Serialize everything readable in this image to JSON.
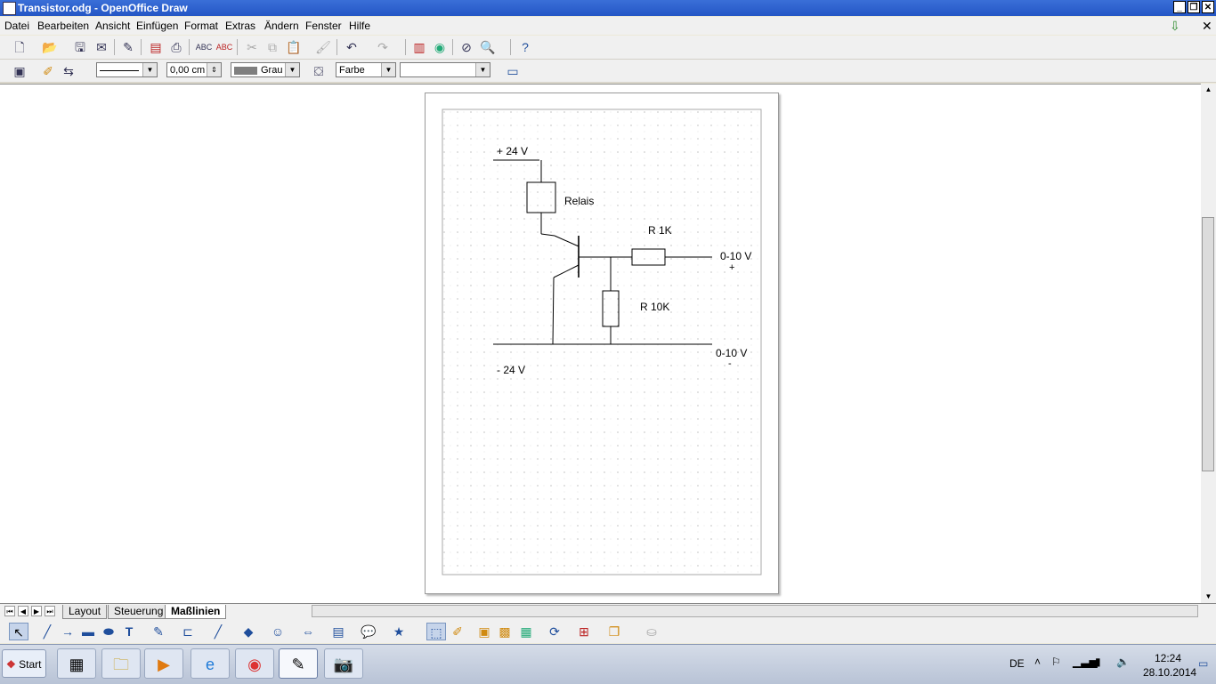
{
  "window": {
    "title": "Transistor.odg - OpenOffice Draw",
    "minimize": "_",
    "restore": "❐",
    "close": "✕"
  },
  "menu": {
    "items": [
      "Datei",
      "Bearbeiten",
      "Ansicht",
      "Einfügen",
      "Format",
      "Extras",
      "Ändern",
      "Fenster",
      "Hilfe"
    ],
    "doc_close": "✕"
  },
  "linebar": {
    "line_width": "0,00 cm",
    "area_color": "Grau",
    "area_style": "Farbe",
    "area_fill": ""
  },
  "drawing": {
    "label_plus24": "+ 24 V",
    "label_relais": "Relais",
    "label_r1k": "R 1K",
    "label_out_plus": "0-10 V",
    "sign_plus": "+",
    "label_r10k": "R 10K",
    "label_out_minus": "0-10 V",
    "sign_minus": "-",
    "label_minus24": "- 24 V"
  },
  "tabs": {
    "items": [
      "Layout",
      "Steuerung",
      "Maßlinien"
    ],
    "active": "Maßlinien"
  },
  "taskbar": {
    "start": "Start",
    "lang": "DE",
    "time": "12:24",
    "date": "28.10.2014"
  },
  "icons": {
    "new": "new-document-icon",
    "open": "open-folder-icon",
    "save": "save-icon",
    "select": "select-arrow-icon",
    "line": "line-icon",
    "rectangle": "rectangle-icon",
    "ellipse": "ellipse-icon",
    "text": "text-icon"
  }
}
